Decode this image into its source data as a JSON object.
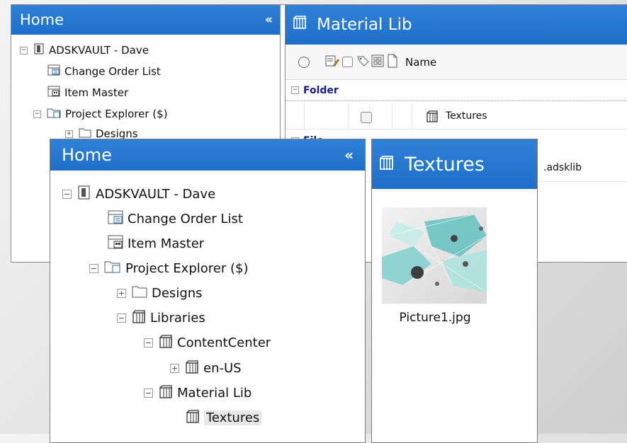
{
  "back_window": {
    "home_title": "Home",
    "collapse_glyph": "«",
    "tree": [
      {
        "label": "ADSKVAULT - Dave",
        "toggle": "−"
      },
      {
        "label": "Change Order List"
      },
      {
        "label": "Item Master"
      },
      {
        "label": "Project Explorer ($)",
        "toggle": "−"
      },
      {
        "label": "Designs",
        "toggle": "+"
      }
    ],
    "content_title": "Material Lib",
    "grid": {
      "name_header": "Name",
      "group_folder": "Folder",
      "group_file": "File",
      "folder_row_name": "Textures",
      "file_row_name_partial": ".adsklib"
    }
  },
  "front_window": {
    "home_title": "Home",
    "collapse_glyph": "«",
    "tree": [
      {
        "label": "ADSKVAULT - Dave",
        "toggle": "−"
      },
      {
        "label": "Change Order List"
      },
      {
        "label": "Item Master"
      },
      {
        "label": "Project Explorer ($)",
        "toggle": "−"
      },
      {
        "label": "Designs",
        "toggle": "+"
      },
      {
        "label": "Libraries",
        "toggle": "−"
      },
      {
        "label": "ContentCenter",
        "toggle": "−"
      },
      {
        "label": "en-US",
        "toggle": "+"
      },
      {
        "label": "Material Lib",
        "toggle": "−"
      },
      {
        "label": "Textures",
        "selected": true
      }
    ],
    "content_title": "Textures",
    "thumbnail": {
      "filename": "Picture1.jpg"
    }
  },
  "colors": {
    "header_blue": "#1d6fc9",
    "group_text": "#1a1a8c"
  }
}
